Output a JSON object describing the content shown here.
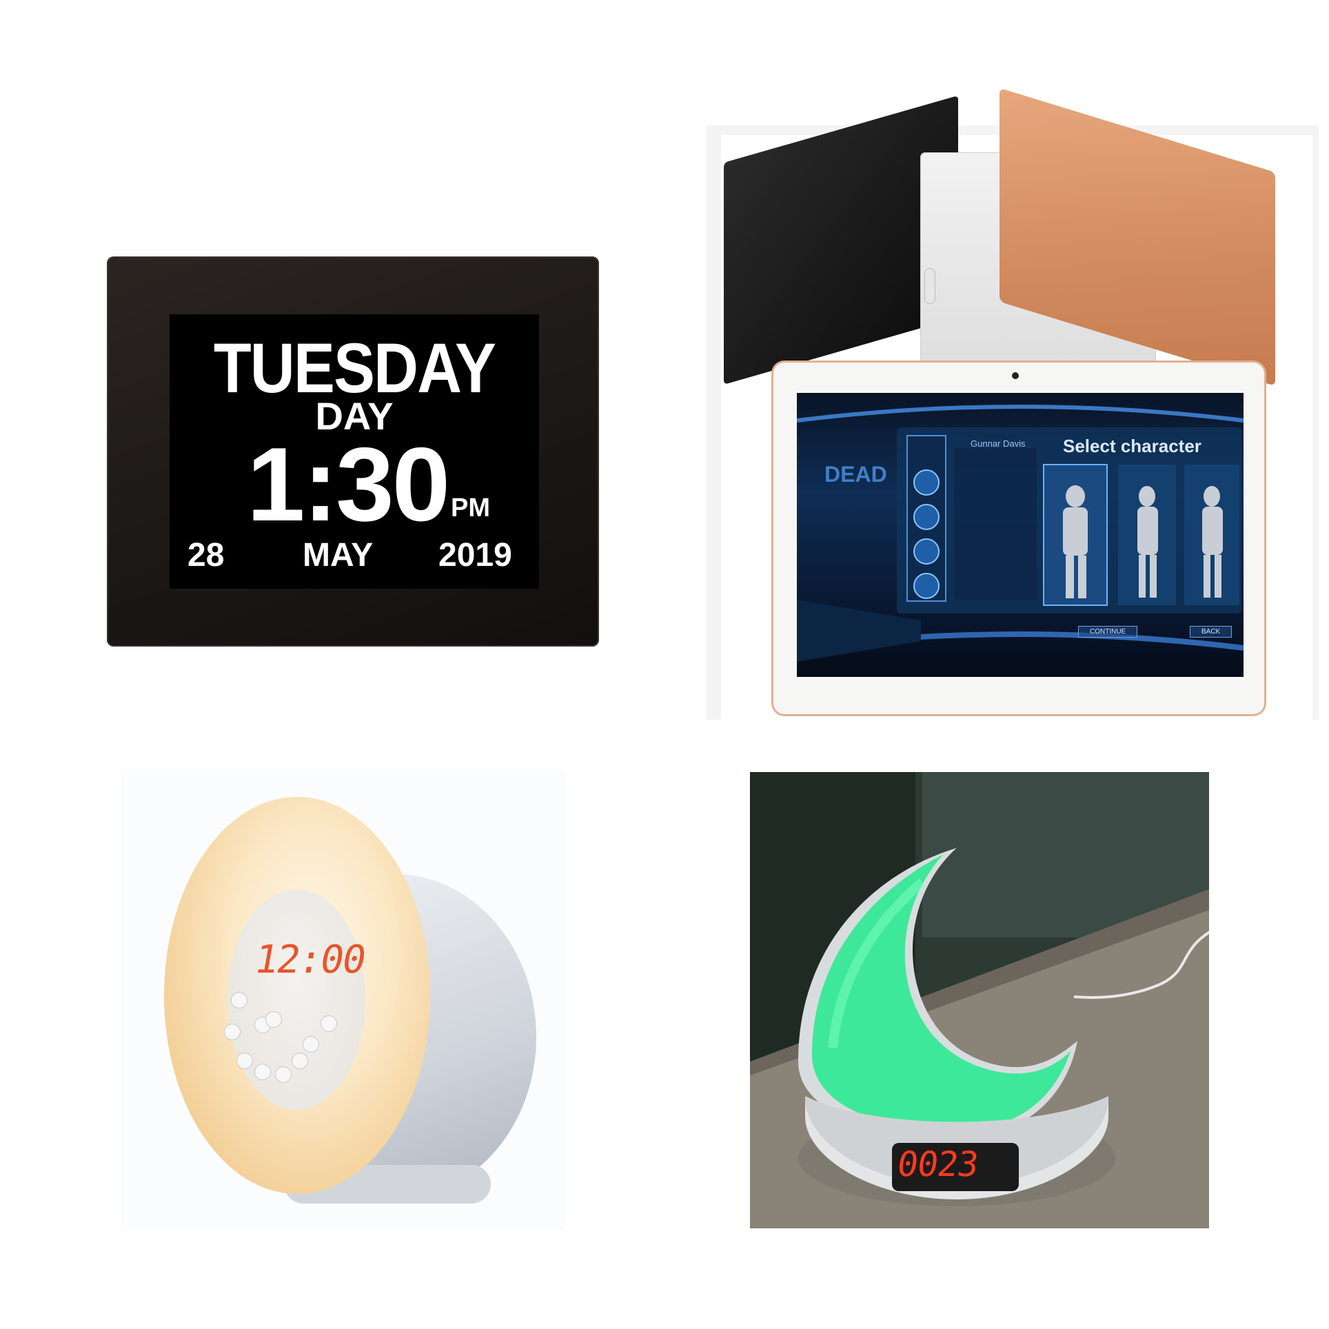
{
  "day_clock": {
    "weekday": "TUESDAY",
    "period_label": "DAY",
    "time": "1:30",
    "ampm": "PM",
    "date": "28",
    "month": "MAY",
    "year": "2019",
    "frame_color": "#1c1816",
    "screen_color": "#000000"
  },
  "tablets": {
    "colors": [
      "#111111",
      "#e8e8e8",
      "#d08a5e"
    ],
    "game_screen": {
      "title": "Select character",
      "subtitle": "Gunnar Davis",
      "logo": "DEAD",
      "continue_button": "CONTINUE",
      "back_button": "BACK"
    }
  },
  "sunrise_lamp": {
    "display_time": "12:00",
    "display_color": "#e9542b",
    "glow_color": "#f3cf97"
  },
  "moon_lamp": {
    "display_time": "0023",
    "display_color": "#ff3b1e",
    "glow_color": "#3ee89a"
  }
}
